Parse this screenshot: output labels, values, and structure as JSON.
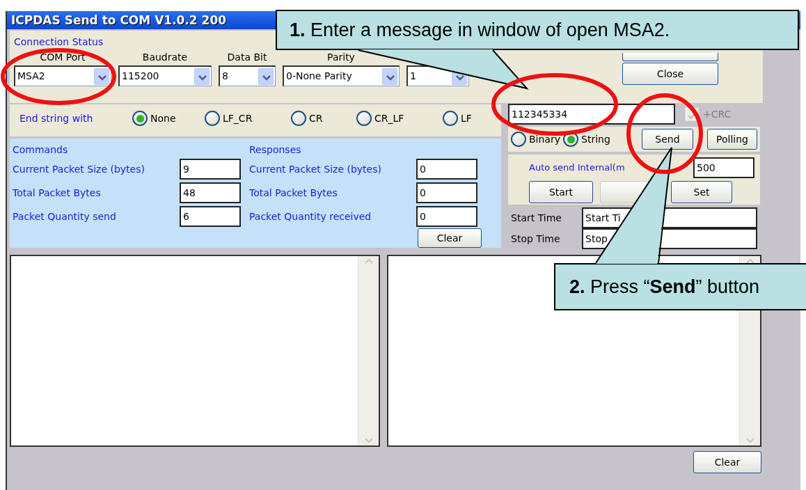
{
  "window": {
    "title": "ICPDAS Send to COM V1.0.2  200"
  },
  "connection": {
    "label": "Connection Status",
    "fields": [
      {
        "label": "COM Port",
        "value": "MSA2"
      },
      {
        "label": "Baudrate",
        "value": "115200"
      },
      {
        "label": "Data Bit",
        "value": "8"
      },
      {
        "label": "Parity",
        "value": "0-None Parity"
      },
      {
        "value": "1"
      }
    ]
  },
  "close_button": "Close",
  "end_string": {
    "label": "End string with",
    "options": [
      {
        "label": "None",
        "selected": true
      },
      {
        "label": "LF_CR",
        "selected": false
      },
      {
        "label": "CR",
        "selected": false
      },
      {
        "label": "CR_LF",
        "selected": false
      },
      {
        "label": "LF",
        "selected": false
      }
    ]
  },
  "message": {
    "value": "112345334"
  },
  "crc": {
    "label": "+CRC",
    "checked": true,
    "disabled": true
  },
  "format": [
    {
      "label": "Binary",
      "selected": false
    },
    {
      "label": "String",
      "selected": true
    }
  ],
  "send_button": "Send",
  "polling_button": "Polling",
  "commands": {
    "title": "Commands",
    "rows": [
      {
        "label": "Current Packet Size (bytes)",
        "value": "9"
      },
      {
        "label": "Total Packet Bytes",
        "value": "48"
      },
      {
        "label": "Packet Quantity send",
        "value": "6"
      }
    ]
  },
  "responses": {
    "title": "Responses",
    "rows": [
      {
        "label": "Current Packet Size (bytes)",
        "value": "0"
      },
      {
        "label": "Total Packet Bytes",
        "value": "0"
      },
      {
        "label": "Packet Quantity received",
        "value": "0"
      }
    ]
  },
  "responses_clear": "Clear",
  "auto_send": {
    "label": "Auto send Internal(m",
    "interval": "500",
    "buttons": [
      {
        "label": "Start",
        "disabled": false
      },
      {
        "disabled": true
      },
      {
        "label": "Set",
        "disabled": false
      }
    ]
  },
  "times": [
    {
      "label": "Start Time",
      "value": "Start Ti"
    },
    {
      "label": "Stop Time",
      "value": "Stop"
    }
  ],
  "log_clear": "Clear",
  "callouts": [
    {
      "text": "**1.** Enter a message in window of open MSA2."
    },
    {
      "text": "**2.** Press “**Send**” button"
    }
  ]
}
